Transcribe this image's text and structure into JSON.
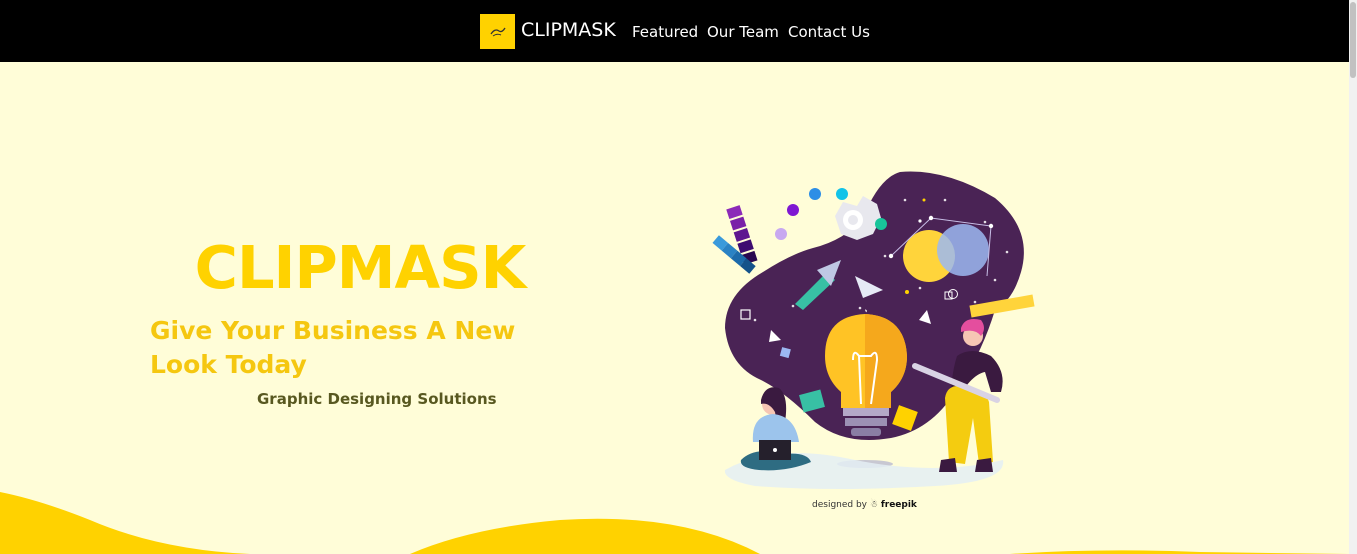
{
  "header": {
    "brand_name": "CLIPMASK",
    "logo_icon": "brush-logo-icon",
    "nav": [
      {
        "label": "Featured"
      },
      {
        "label": "Our Team"
      },
      {
        "label": "Contact Us"
      }
    ]
  },
  "hero": {
    "title": "CLIPMASK",
    "subtitle": "Give Your Business A New Look Today",
    "tagline": "Graphic Designing Solutions"
  },
  "illustration": {
    "credit_prefix": "designed by",
    "credit_brand": "freepik"
  },
  "colors": {
    "accent": "#FFD200",
    "background": "#FFFDD8",
    "navbar": "#000000",
    "blob": "#4A2355"
  }
}
